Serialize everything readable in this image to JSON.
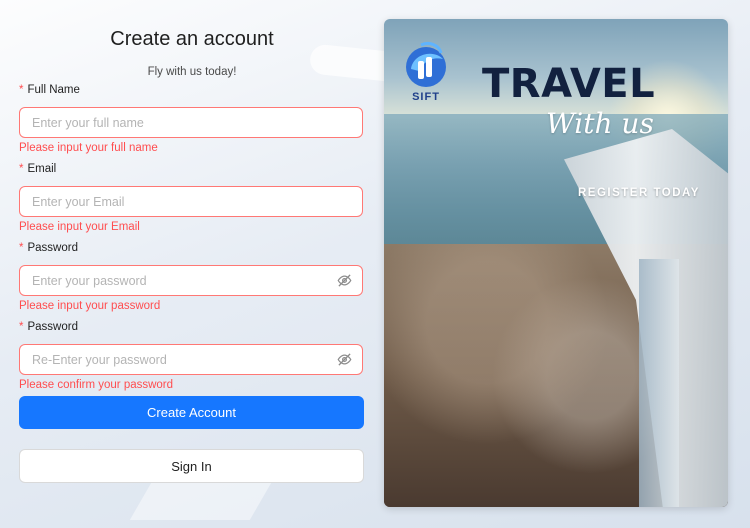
{
  "form": {
    "title": "Create an account",
    "subtitle": "Fly with us today!",
    "fields": [
      {
        "label": "Full Name",
        "required_mark": "*",
        "placeholder": "Enter your full name",
        "value": "",
        "error": "Please input your full name"
      },
      {
        "label": "Email",
        "required_mark": "*",
        "placeholder": "Enter your Email",
        "value": "",
        "error": "Please input your Email"
      },
      {
        "label": "Password",
        "required_mark": "*",
        "placeholder": "Enter your password",
        "value": "",
        "error": "Please input your password",
        "icon": "eye-hidden-icon"
      },
      {
        "label": "Password",
        "required_mark": "*",
        "placeholder": "Re-Enter your password",
        "value": "",
        "error": "Please confirm your password",
        "icon": "eye-hidden-icon"
      }
    ],
    "primary_button": "Create Account",
    "secondary_button": "Sign In"
  },
  "poster": {
    "brand": "SIFT",
    "headline": "TRAVEL",
    "script": "With us",
    "cta": "REGISTER TODAY"
  },
  "colors": {
    "primary": "#1677ff",
    "error": "#ff4d4f",
    "headline": "#12213f",
    "brand": "#1f3f8a"
  }
}
